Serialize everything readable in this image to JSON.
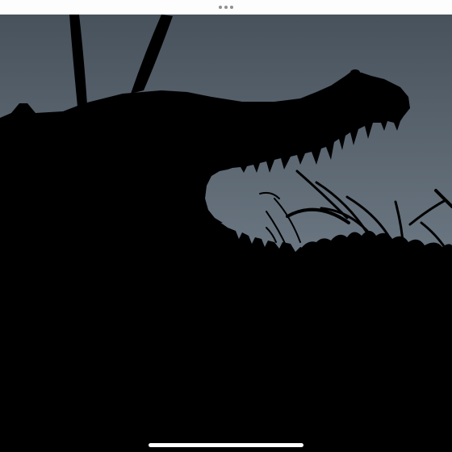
{
  "window": {
    "multitasking_control": "more-dots-icon",
    "home_indicator": "home-indicator-bar"
  },
  "photo": {
    "subject": "crocodile-silhouette",
    "colors": {
      "sky_top": "#48525c",
      "sky_bottom": "#6f7b86",
      "silhouette": "#000000",
      "top_bar": "#fdfdfd",
      "dots": "#8e8e93",
      "home_indicator": "#ffffff"
    }
  }
}
